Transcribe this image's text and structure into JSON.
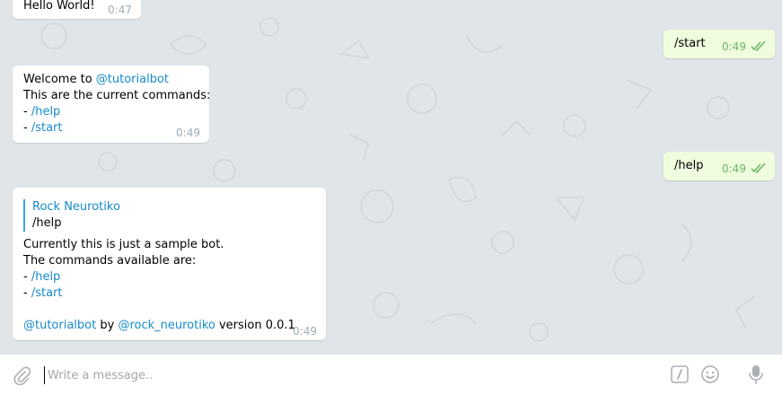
{
  "messages": {
    "m1": {
      "text": "Hello World!",
      "time": "0:47"
    },
    "m2": {
      "text": "/start",
      "time": "0:49"
    },
    "m3": {
      "line1_prefix": "Welcome to ",
      "line1_link": "@tutorialbot",
      "line2": "This are the current commands:",
      "dash": "- ",
      "cmd1": "/help",
      "cmd2": "/start",
      "time": "0:49"
    },
    "m4": {
      "text": "/help",
      "time": "0:49"
    },
    "m5": {
      "reply_name": "Rock Neurotiko",
      "reply_text": "/help",
      "line1": "Currently this is just a sample bot.",
      "line2": "The commands available are:",
      "dash": "- ",
      "cmd1": "/help",
      "cmd2": "/start",
      "footer_link1": "@tutorialbot",
      "footer_by": " by ",
      "footer_link2": "@rock_neurotiko",
      "footer_version": " version 0.0.1",
      "time": "0:49"
    }
  },
  "composer": {
    "placeholder": "Write a message.."
  },
  "colors": {
    "background": "#dfe5e9",
    "outgoing_bubble": "#effdde",
    "link": "#168acd",
    "read_check": "#6cb765"
  }
}
